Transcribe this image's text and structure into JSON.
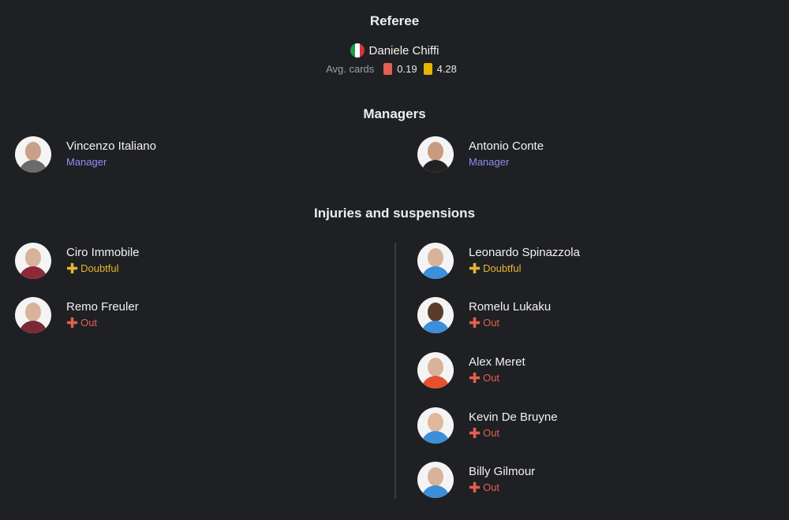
{
  "referee": {
    "title": "Referee",
    "name": "Daniele Chiffi",
    "flag_icon": "italy-flag-icon",
    "avg_cards_label": "Avg. cards",
    "red_avg": "0.19",
    "yellow_avg": "4.28"
  },
  "managers": {
    "title": "Managers",
    "home": {
      "name": "Vincenzo Italiano",
      "role": "Manager"
    },
    "away": {
      "name": "Antonio Conte",
      "role": "Manager"
    }
  },
  "injuries": {
    "title": "Injuries and suspensions",
    "home": [
      {
        "name": "Ciro Immobile",
        "status": "Doubtful"
      },
      {
        "name": "Remo Freuler",
        "status": "Out"
      }
    ],
    "away": [
      {
        "name": "Leonardo Spinazzola",
        "status": "Doubtful"
      },
      {
        "name": "Romelu Lukaku",
        "status": "Out"
      },
      {
        "name": "Alex Meret",
        "status": "Out"
      },
      {
        "name": "Kevin De Bruyne",
        "status": "Out"
      },
      {
        "name": "Billy Gilmour",
        "status": "Out"
      }
    ]
  },
  "colors": {
    "background": "#1f2023",
    "manager_role": "#8f8df5",
    "doubtful": "#e5b533",
    "out": "#e2604f",
    "red_card": "#e2604f",
    "yellow_card": "#e5b500"
  }
}
